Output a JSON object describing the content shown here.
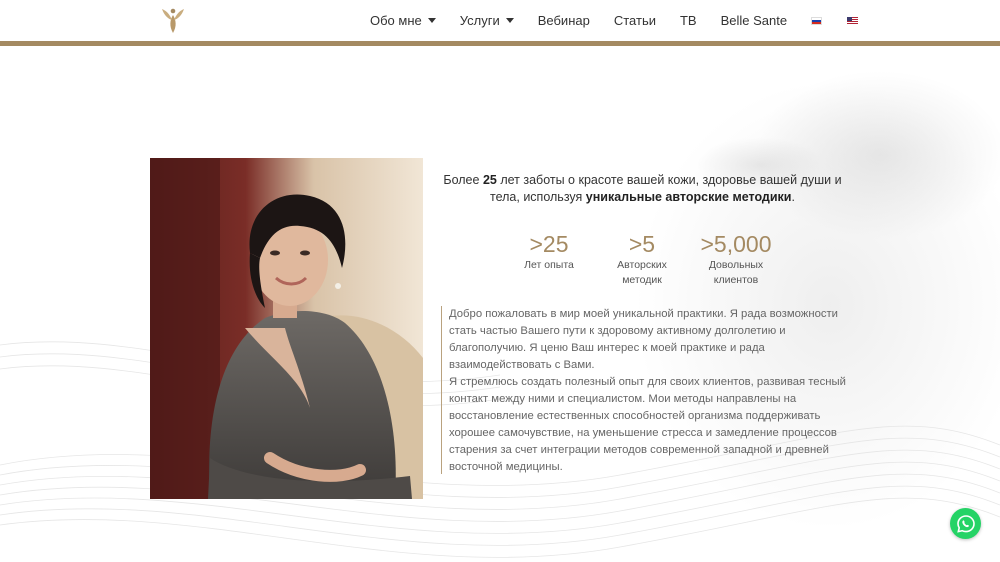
{
  "header": {
    "logo_icon": "lotus-figure-logo",
    "nav": [
      {
        "label": "Обо мне",
        "dropdown": true
      },
      {
        "label": "Услуги",
        "dropdown": true
      },
      {
        "label": "Вебинар",
        "dropdown": false
      },
      {
        "label": "Статьи",
        "dropdown": false
      },
      {
        "label": "ТВ",
        "dropdown": false
      },
      {
        "label": "Belle Sante",
        "dropdown": false
      }
    ],
    "languages": [
      "ru-flag-icon",
      "us-flag-icon"
    ]
  },
  "intro": {
    "part1": "Более ",
    "years_bold": "25",
    "part2": " лет заботы о красоте вашей кожи, здоровье вашей души и тела, используя ",
    "methods_bold": "уникальные авторские методики",
    "part3": "."
  },
  "stats": [
    {
      "value": ">25",
      "label": "Лет опыта"
    },
    {
      "value": ">5",
      "label": "Авторских методик"
    },
    {
      "value": ">5,000",
      "label": "Довольных клиентов"
    }
  ],
  "description": {
    "p1": "Добро пожаловать в мир моей уникальной практики. Я рада возможности стать частью Вашего пути к здоровому активному долголетию и благополучию. Я ценю Ваш интерес к моей практике и рада взаимодействовать с Вами.",
    "p2": "Я стремлюсь создать полезный опыт для своих клиентов, развивая тесный контакт между ними и специалистом. Мои методы направлены на восстановление естественных способностей организма поддерживать хорошее самочувствие, на уменьшение стресса и замедление процессов старения за счет интеграции методов современной западной и древней восточной медицины."
  },
  "colors": {
    "accent": "#a48a62",
    "whatsapp": "#25d366"
  },
  "floating": {
    "icon": "whatsapp-icon"
  }
}
